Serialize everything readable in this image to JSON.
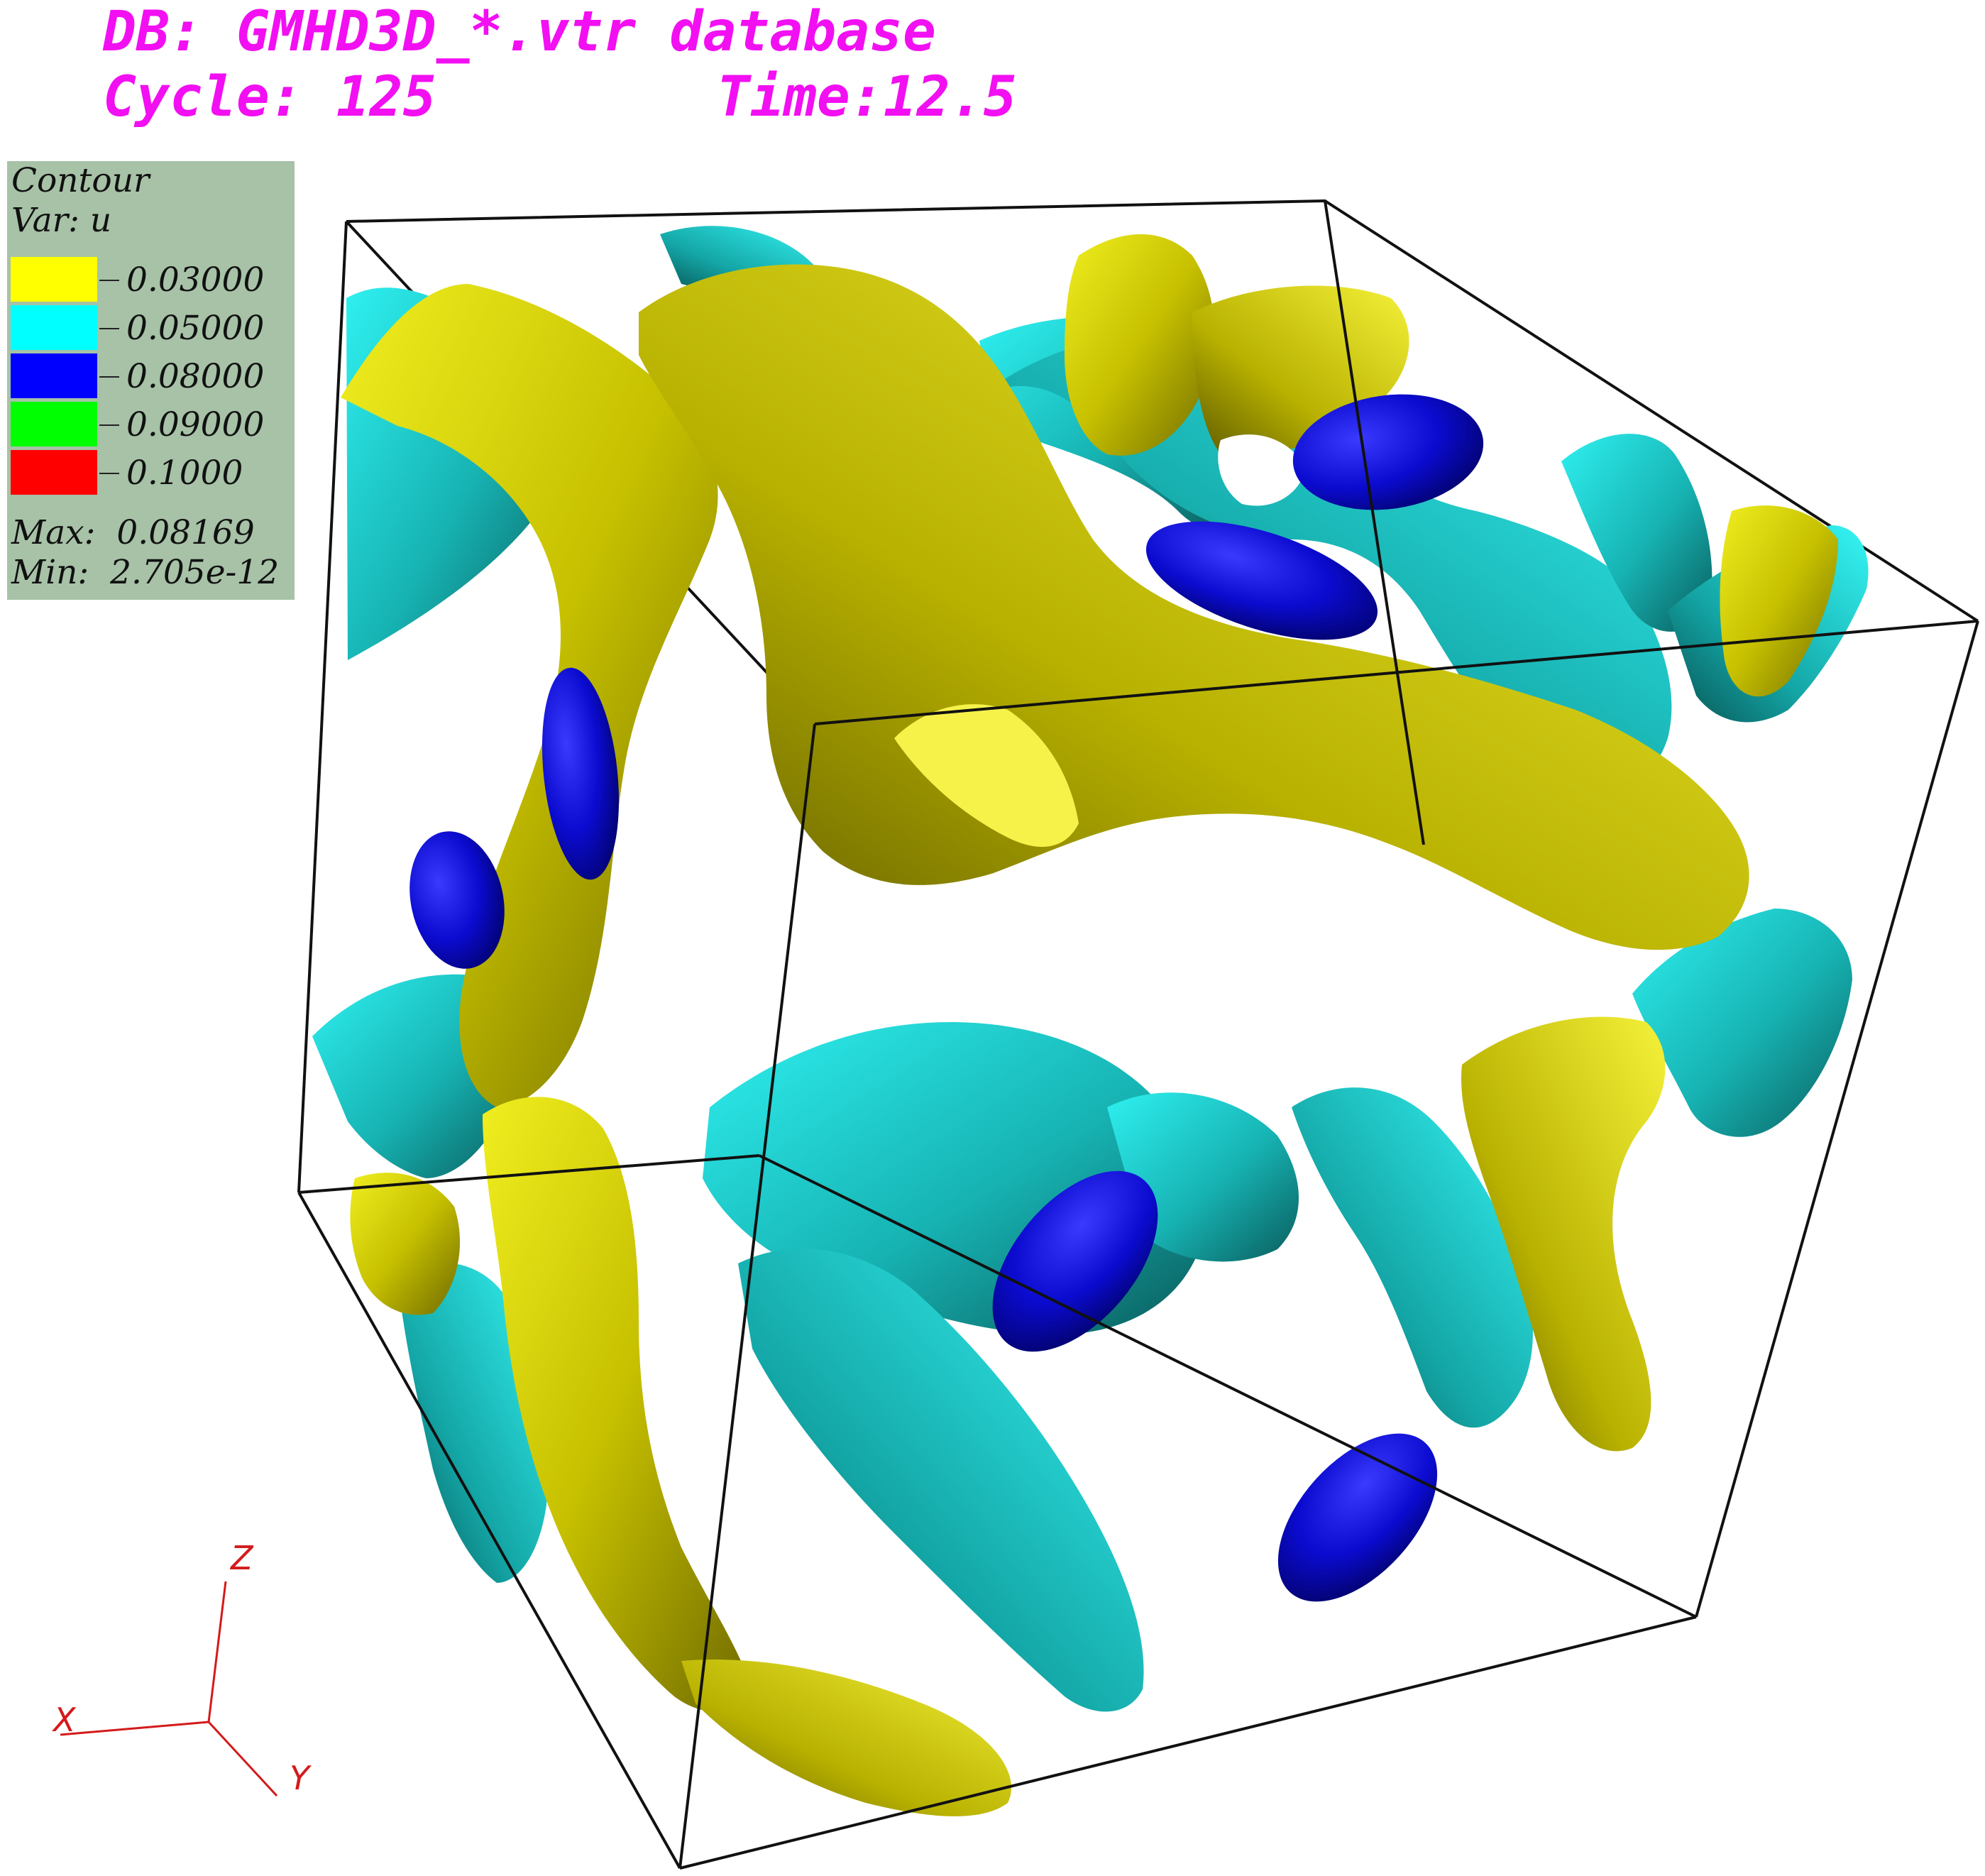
{
  "header": {
    "db_label": "DB: GMHD3D_*.vtr database",
    "cycle_label": "Cycle: 125",
    "time_label": "Time:12.5"
  },
  "legend": {
    "title": "Contour",
    "var_label": "Var: u",
    "levels": [
      {
        "value": "0.03000",
        "color": "#ffff00"
      },
      {
        "value": "0.05000",
        "color": "#00ffff"
      },
      {
        "value": "0.08000",
        "color": "#0000ff"
      },
      {
        "value": "0.09000",
        "color": "#00ff00"
      },
      {
        "value": "0.1000",
        "color": "#ff0000"
      }
    ],
    "max_label": "Max:  0.08169",
    "min_label": "Min:  2.705e-12"
  },
  "triad": {
    "x_label": "X",
    "y_label": "Y",
    "z_label": "Z"
  },
  "colors": {
    "header_text": "#f20ff2",
    "legend_bg": "#a7c2a7",
    "surface_yellow": "#c8c200",
    "surface_cyan": "#19b8b8",
    "surface_blue": "#0a0ac8",
    "triad": "#d41a1a"
  }
}
